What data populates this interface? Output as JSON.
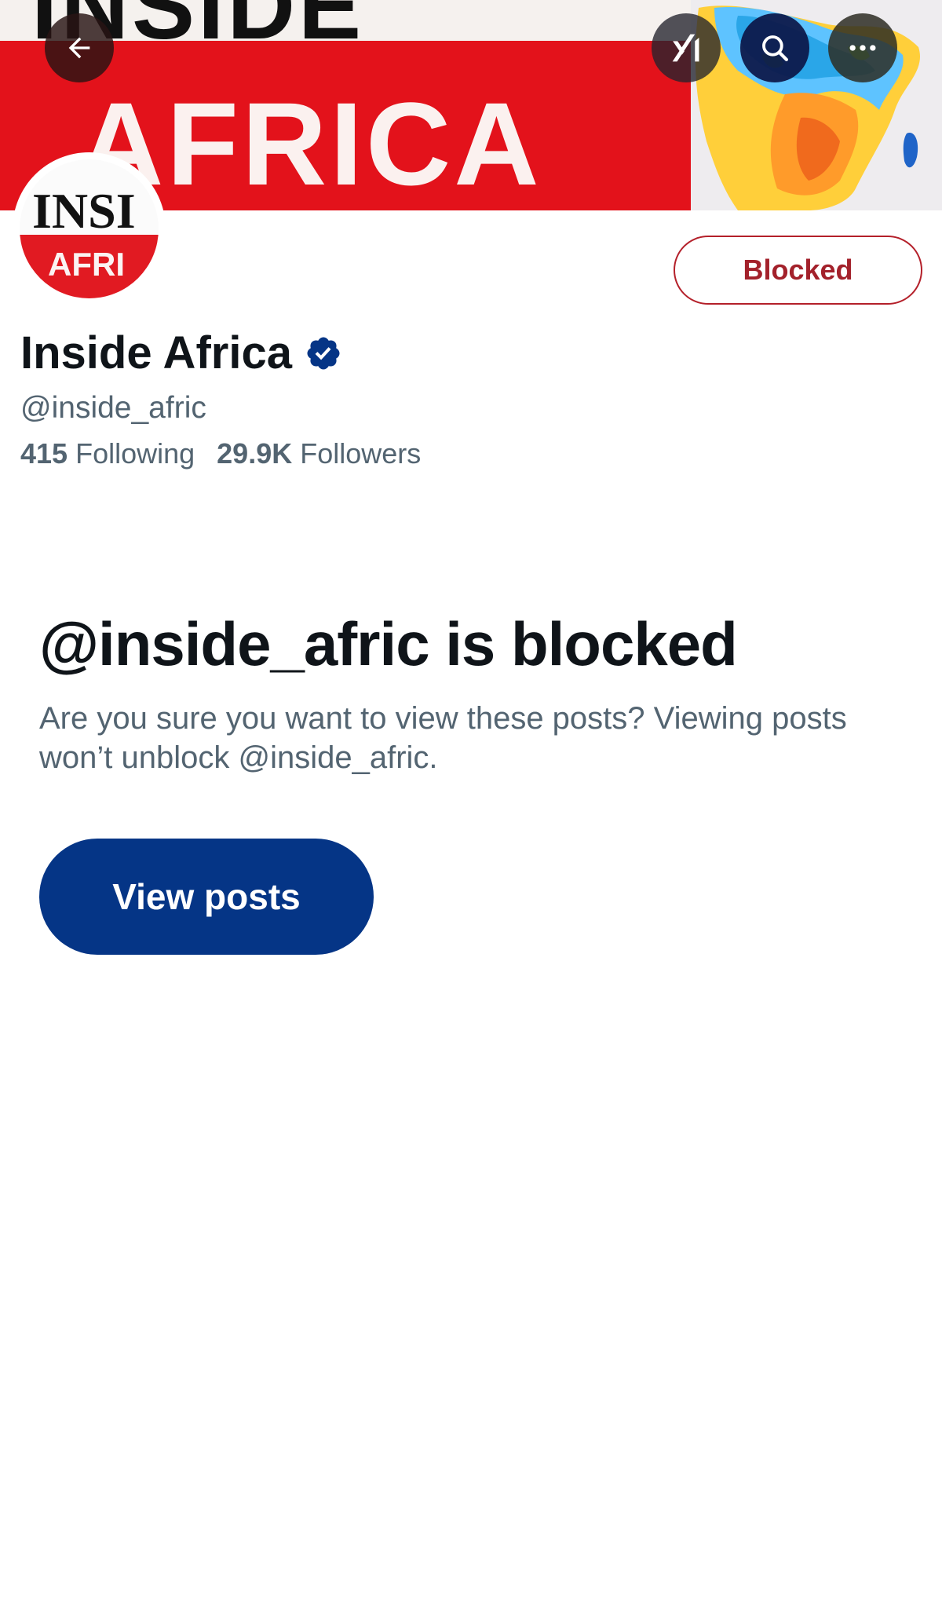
{
  "header": {
    "banner_text_primary": "AFRICA",
    "banner_text_top": "INSIDE",
    "back_icon": "arrow-left-icon",
    "grok_icon": "grok-icon",
    "search_icon": "search-icon",
    "more_icon": "more-horizontal-icon"
  },
  "profile": {
    "avatar_text_top": "INSI",
    "avatar_text_bottom": "AFRI",
    "display_name": "Inside Africa",
    "verified_icon": "verified-badge-icon",
    "handle": "@inside_afric",
    "following_count": "415",
    "following_label": "Following",
    "followers_count": "29.9K",
    "followers_label": "Followers",
    "blocked_button_label": "Blocked"
  },
  "notice": {
    "title": "@inside_afric is blocked",
    "body": "Are you sure you want to view these posts? Viewing posts won’t unblock @inside_afric.",
    "view_button_label": "View posts"
  },
  "colors": {
    "accent_blue": "#053586",
    "blocked_red": "#a3212b",
    "verified_blue": "#053586",
    "secondary_text": "#536471"
  }
}
